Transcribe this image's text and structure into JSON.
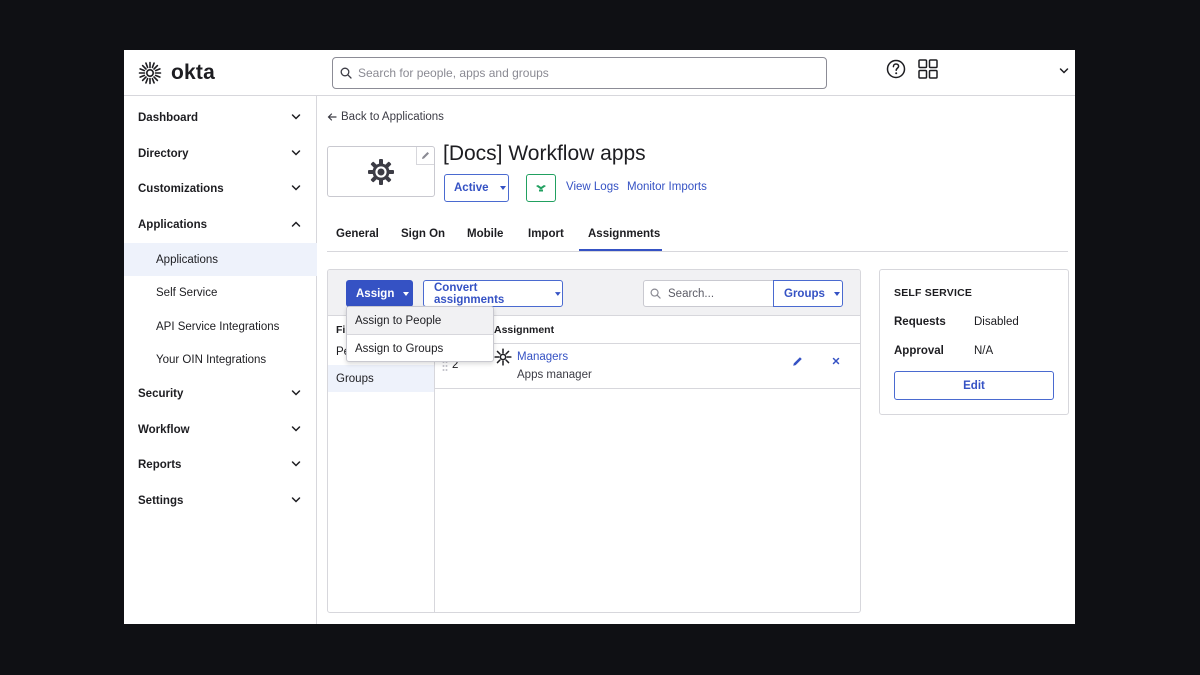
{
  "header": {
    "logo_text": "okta",
    "search_placeholder": "Search for people, apps and groups",
    "icons": {
      "search": "search-icon",
      "help": "help-icon",
      "apps": "app-grid-icon",
      "user_menu": "chevron-down-icon"
    }
  },
  "sidebar": {
    "items": [
      {
        "label": "Dashboard",
        "expanded": false
      },
      {
        "label": "Directory",
        "expanded": false
      },
      {
        "label": "Customizations",
        "expanded": false
      },
      {
        "label": "Applications",
        "expanded": true
      },
      {
        "label": "Security",
        "expanded": false
      },
      {
        "label": "Workflow",
        "expanded": false
      },
      {
        "label": "Reports",
        "expanded": false
      },
      {
        "label": "Settings",
        "expanded": false
      }
    ],
    "subitems": [
      {
        "label": "Applications",
        "active": true
      },
      {
        "label": "Self Service",
        "active": false
      },
      {
        "label": "API Service Integrations",
        "active": false
      },
      {
        "label": "Your OIN Integrations",
        "active": false
      }
    ]
  },
  "app": {
    "back_label": "Back to Applications",
    "title": "[Docs] Workflow apps",
    "status": "Active",
    "view_logs": "View Logs",
    "monitor_imports": "Monitor Imports"
  },
  "tabs": [
    "General",
    "Sign On",
    "Mobile",
    "Import",
    "Assignments"
  ],
  "active_tab": "Assignments",
  "assignments": {
    "assign_button": "Assign",
    "convert_button": "Convert assignments",
    "search_placeholder": "Search...",
    "filter_select": "Groups",
    "filters_header": "Fi",
    "filters": [
      "Pe",
      "Groups"
    ],
    "active_filter": "Groups",
    "column_header": "Assignment",
    "rows": [
      {
        "priority": "2",
        "name": "Managers",
        "description": "Apps manager"
      }
    ],
    "assign_menu": [
      "Assign to People",
      "Assign to Groups"
    ]
  },
  "self_service": {
    "title": "SELF SERVICE",
    "requests_label": "Requests",
    "requests_value": "Disabled",
    "approval_label": "Approval",
    "approval_value": "N/A",
    "edit_button": "Edit"
  },
  "colors": {
    "primary": "#3552c4",
    "active_bg": "#eef2fb",
    "border": "#d7d7dc",
    "push_green": "#21a060"
  }
}
